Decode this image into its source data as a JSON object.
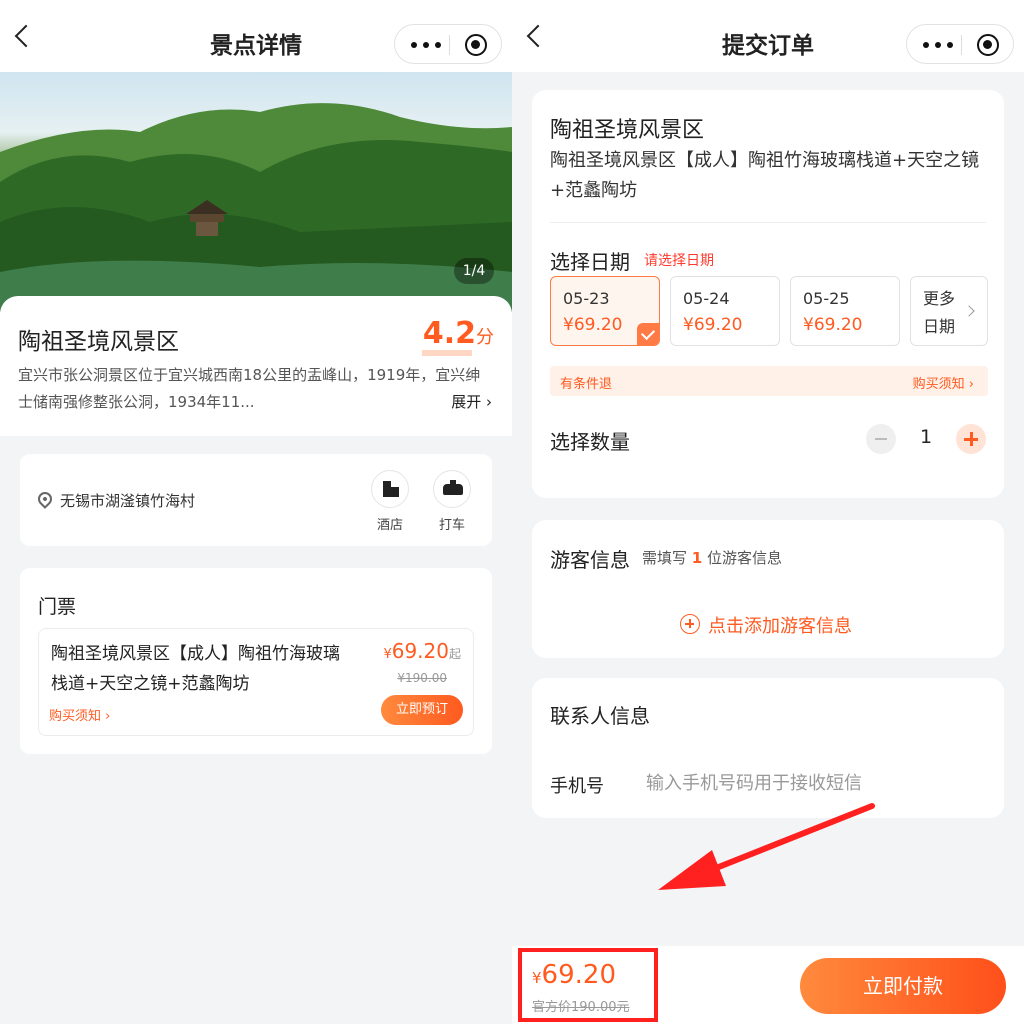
{
  "left": {
    "nav": {
      "title": "景点详情"
    },
    "hero": {
      "counter": "1/4"
    },
    "spot": {
      "title": "陶祖圣境风景区",
      "rating_value": "4.2",
      "rating_unit": "分",
      "description": "宜兴市张公洞景区位于宜兴城西南18公里的盂峰山，1919年，宜兴绅士储南强修整张公洞，1934年11...",
      "expand_label": "展开 ›"
    },
    "location": {
      "address": "无锡市湖滏镇竹海村",
      "hotel_label": "酒店",
      "taxi_label": "打车"
    },
    "tickets": {
      "heading": "门票",
      "item": {
        "name": "陶祖圣境风景区【成人】陶祖竹海玻璃栈道+天空之镜+范蠡陶坊",
        "currency": "¥",
        "price": "69.20",
        "price_suffix": "起",
        "original_price": "¥190.00",
        "notice_label": "购买须知 ›",
        "book_label": "立即预订"
      }
    }
  },
  "right": {
    "nav": {
      "title": "提交订单"
    },
    "order": {
      "title": "陶祖圣境风景区",
      "subtitle": "陶祖圣境风景区【成人】陶祖竹海玻璃栈道+天空之镜+范蠡陶坊",
      "date_heading": "选择日期",
      "date_hint": "请选择日期",
      "dates": [
        {
          "date": "05-23",
          "price": "¥69.20",
          "selected": true
        },
        {
          "date": "05-24",
          "price": "¥69.20",
          "selected": false
        },
        {
          "date": "05-25",
          "price": "¥69.20",
          "selected": false
        }
      ],
      "more_dates_label": "更多日期",
      "refund_label": "有条件退",
      "purchase_notice_label": "购买须知 ›",
      "quantity_heading": "选择数量",
      "quantity": "1"
    },
    "guest": {
      "title": "游客信息",
      "hint_prefix": "需填写",
      "hint_count": "1",
      "hint_suffix": "位游客信息",
      "add_label": "点击添加游客信息"
    },
    "contact": {
      "title": "联系人信息",
      "phone_label": "手机号",
      "phone_placeholder": "输入手机号码用于接收短信"
    },
    "footer": {
      "currency": "¥",
      "total": "69.20",
      "official_price": "官方价190.00元",
      "pay_label": "立即付款"
    }
  },
  "colors": {
    "accent": "#ff5a1f",
    "accent_light": "#ff8a3d",
    "highlight_box": "#ff2020",
    "background": "#f3f4f6"
  }
}
